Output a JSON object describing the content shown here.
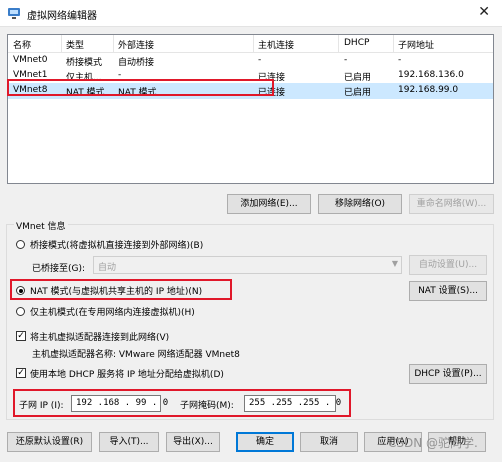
{
  "window": {
    "title": "虚拟网络编辑器",
    "close_icon": "close-icon"
  },
  "network_list": {
    "columns": [
      "名称",
      "类型",
      "外部连接",
      "主机连接",
      "DHCP",
      "子网地址"
    ],
    "rows": [
      [
        "VMnet0",
        "桥接模式",
        "自动桥接",
        "-",
        "-",
        "-"
      ],
      [
        "VMnet1",
        "仅主机...",
        "-",
        "已连接",
        "已启用",
        "192.168.136.0"
      ],
      [
        "VMnet8",
        "NAT 模式",
        "NAT 模式",
        "已连接",
        "已启用",
        "192.168.99.0"
      ]
    ],
    "selected_row": 2
  },
  "list_buttons": {
    "add": "添加网络(E)...",
    "remove": "移除网络(O)",
    "rename": "重命名网络(W)..."
  },
  "vmnet_info": {
    "title": "VMnet 信息",
    "bridged_label": "桥接模式(将虚拟机直接连接到外部网络)(B)",
    "bridged_to_label": "已桥接至(G):",
    "bridged_to_value": "自动",
    "auto_settings_button": "自动设置(U)...",
    "nat_label": "NAT 模式(与虚拟机共享主机的 IP 地址)(N)",
    "nat_settings_button": "NAT 设置(S)...",
    "hostonly_label": "仅主机模式(在专用网络内连接虚拟机)(H)",
    "selected_mode": "nat",
    "connect_adapter_label": "将主机虚拟适配器连接到此网络(V)",
    "connect_adapter_checked": true,
    "adapter_name_label": "主机虚拟适配器名称: VMware 网络适配器 VMnet8",
    "dhcp_label": "使用本地 DHCP 服务将 IP 地址分配给虚拟机(D)",
    "dhcp_checked": true,
    "dhcp_settings_button": "DHCP 设置(P)...",
    "subnet_ip_label": "子网 IP (I):",
    "subnet_ip_value": "192 .168 . 99 . 0",
    "subnet_mask_label": "子网掩码(M):",
    "subnet_mask_value": "255 .255 .255 . 0"
  },
  "footer_buttons": {
    "restore": "还原默认设置(R)",
    "import": "导入(T)...",
    "export": "导出(X)...",
    "ok": "确定",
    "cancel": "取消",
    "apply": "应用(A)",
    "help": "帮助"
  },
  "watermark": "CSDN @驼同学.",
  "colors": {
    "highlight": "#e0182a",
    "selection": "#cce8ff",
    "default_border": "#0078d7"
  }
}
